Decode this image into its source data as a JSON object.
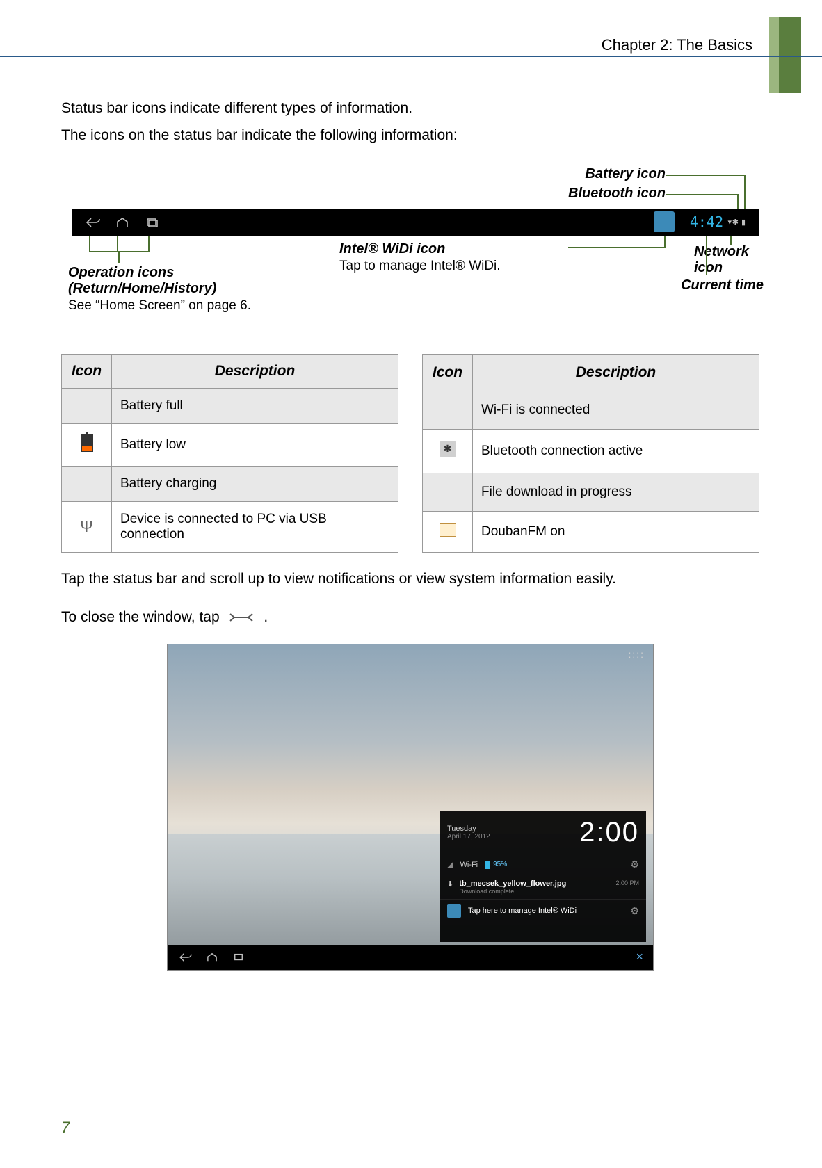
{
  "header": {
    "chapter": "Chapter 2: The Basics"
  },
  "intro": {
    "p1": "Status bar icons indicate different types of information.",
    "p2": "The icons on the status bar indicate the following information:"
  },
  "diagram": {
    "battery_label": "Battery icon",
    "bluetooth_label": "Bluetooth icon",
    "network_label": "Network icon",
    "current_time_label": "Current time",
    "widi_label": "Intel® WiDi",
    "widi_word_icon": " icon",
    "widi_sub": "Tap to manage Intel® WiDi.",
    "ops_line1": "Operation icons",
    "ops_line2": "(Return/Home/History)",
    "ops_sub": "See “Home Screen” on page 6.",
    "time": "4:42"
  },
  "tables": {
    "h_icon": "Icon",
    "h_desc": "Description",
    "left": [
      "Battery full",
      "Battery low",
      "Battery charging",
      "Device is connected to PC via USB connection"
    ],
    "right": [
      "Wi-Fi is connected",
      "Bluetooth connection active",
      "File download in progress",
      "DoubanFM on"
    ]
  },
  "mid": {
    "p1": "Tap the status bar and scroll up to view notifications or view system information easily.",
    "p2a": "To close the window, tap ",
    "p2b": " ."
  },
  "panel": {
    "day": "Tuesday",
    "date": "April 17, 2012",
    "clock": "2:00",
    "wifi_label": "Wi-Fi",
    "batt_pct": "95%",
    "dl_name": "tb_mecsek_yellow_flower.jpg",
    "dl_status": "Download complete",
    "dl_time": "2:00 PM",
    "widi_msg": "Tap here to manage Intel® WiDi"
  },
  "page_number": "7"
}
